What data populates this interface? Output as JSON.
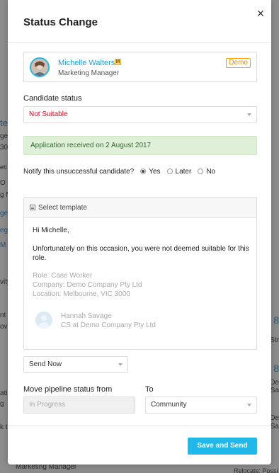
{
  "background": {
    "fragments": [
      "ter",
      "ge",
      "30",
      "eti",
      "O S",
      "g M",
      "ge",
      "egy",
      "M",
      "vity",
      "nt",
      "ovi",
      "ation",
      "g",
      "k t",
      "Marketing Manager",
      "8",
      "Str",
      "8",
      "De",
      "Sa",
      "De",
      "Sa",
      "Relocate: Possi"
    ]
  },
  "modal": {
    "title": "Status Change",
    "close_label": "×",
    "candidate": {
      "name": "Michelle Walters",
      "badge": "M",
      "role": "Marketing Manager",
      "tag": "Demo"
    },
    "status": {
      "label": "Candidate status",
      "value": "Not Suitable",
      "value_color": "#d0021b"
    },
    "alert": "Application received on 2 August 2017",
    "notify": {
      "question": "Notify this unsuccessful candidate?",
      "options": [
        "Yes",
        "Later",
        "No"
      ],
      "selected": "Yes"
    },
    "template": {
      "toolbar_label": "Select template",
      "greeting": "Hi Michelle,",
      "body": "Unfortunately on this occasion, you were not deemed suitable for this role.",
      "role_line": "Role: Case Worker",
      "company_line": "Company: Demo Company Pty Ltd",
      "location_line": "Location: Melbourne, VIC 3000",
      "signature_name": "Hannah Savage",
      "signature_company": "CS at Demo Company Pty Ltd"
    },
    "send": {
      "value": "Send Now"
    },
    "pipeline": {
      "from_label": "Move pipeline status from",
      "from_value": "In Progress",
      "to_label": "To",
      "to_value": "Community"
    },
    "submit_label": "Save and Send",
    "accent_color": "#1fb8e8"
  }
}
